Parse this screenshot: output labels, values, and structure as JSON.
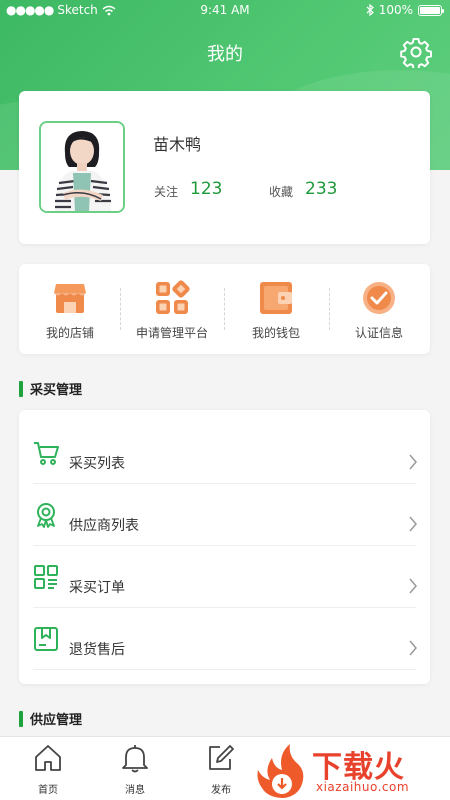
{
  "status_bar": {
    "carrier": "Sketch",
    "time": "9:41 AM",
    "battery": "100%"
  },
  "header": {
    "title": "我的",
    "settings_icon": "gear-icon"
  },
  "profile": {
    "name": "苗木鸭",
    "stats": [
      {
        "label": "关注",
        "value": "123"
      },
      {
        "label": "收藏",
        "value": "233"
      }
    ]
  },
  "quick_actions": [
    {
      "label": "我的店铺",
      "icon": "store-icon"
    },
    {
      "label": "申请管理平台",
      "icon": "apps-grid-icon"
    },
    {
      "label": "我的钱包",
      "icon": "wallet-icon"
    },
    {
      "label": "认证信息",
      "icon": "verified-check-icon"
    }
  ],
  "purchase_section": {
    "title": "采买管理",
    "items": [
      {
        "label": "采买列表",
        "icon": "cart-icon"
      },
      {
        "label": "供应商列表",
        "icon": "badge-icon"
      },
      {
        "label": "采买订单",
        "icon": "order-grid-icon"
      },
      {
        "label": "退货售后",
        "icon": "return-box-icon"
      }
    ]
  },
  "supply_section": {
    "title": "供应管理"
  },
  "tab_bar": [
    {
      "label": "首页",
      "icon": "home-icon"
    },
    {
      "label": "消息",
      "icon": "bell-icon"
    },
    {
      "label": "发布",
      "icon": "edit-icon"
    }
  ],
  "watermark": {
    "text": "下载火",
    "sub": "xiazaihuo.com"
  },
  "colors": {
    "brand_green": "#3db863",
    "stat_green": "#1f9a3a",
    "icon_orange": "#f08a4b",
    "list_icon_green": "#2fb35a"
  }
}
